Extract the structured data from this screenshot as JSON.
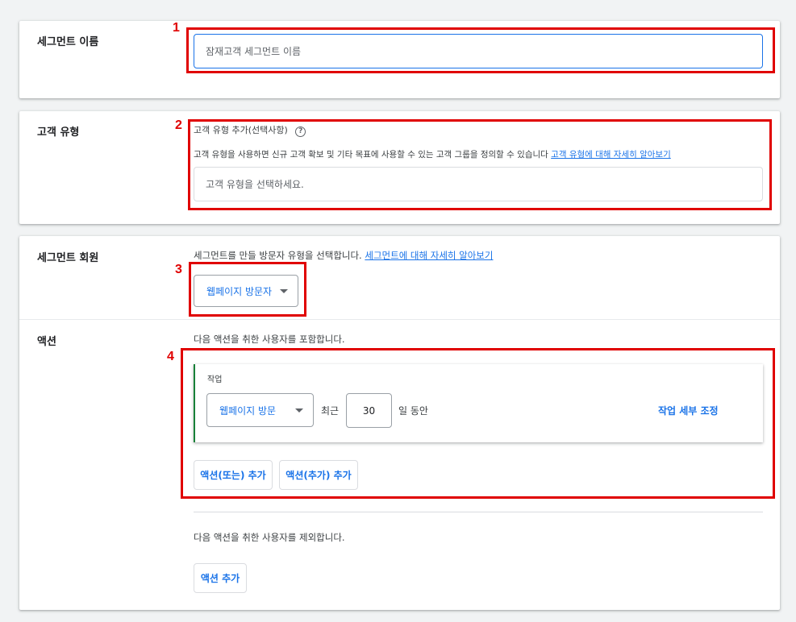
{
  "annotations": [
    "1",
    "2",
    "3",
    "4"
  ],
  "segment_name": {
    "title": "세그먼트 이름",
    "placeholder": "잠재고객 세그먼트 이름"
  },
  "customer_type": {
    "title": "고객 유형",
    "field_label": "고객 유형 추가(선택사항)",
    "description": "고객 유형을 사용하면 신규 고객 확보 및 기타 목표에 사용할 수 있는 고객 그룹을 정의할 수 있습니다",
    "learn_more": "고객 유형에 대해 자세히 알아보기",
    "select_placeholder": "고객 유형을 선택하세요."
  },
  "members": {
    "title": "세그먼트 회원",
    "description": "세그먼트를 만들 방문자 유형을 선택합니다.",
    "learn_more": "세그먼트에 대해 자세히 알아보기",
    "visitor_type": "웹페이지 방문자"
  },
  "actions": {
    "title": "액션",
    "include_text": "다음 액션을 취한 사용자를 포함합니다.",
    "task_label": "작업",
    "task_select": "웹페이지 방문",
    "recent_label": "최근",
    "days_value": "30",
    "days_suffix": "일 동안",
    "refine_label": "작업 세부 조정",
    "add_or": "액션(또는) 추가",
    "add_and": "액션(추가) 추가",
    "exclude_text": "다음 액션을 취한 사용자를 제외합니다.",
    "add_exclude": "액션 추가"
  },
  "colors": {
    "accent": "#1a73e8",
    "annotation": "#e00000",
    "task_border": "#188038"
  }
}
